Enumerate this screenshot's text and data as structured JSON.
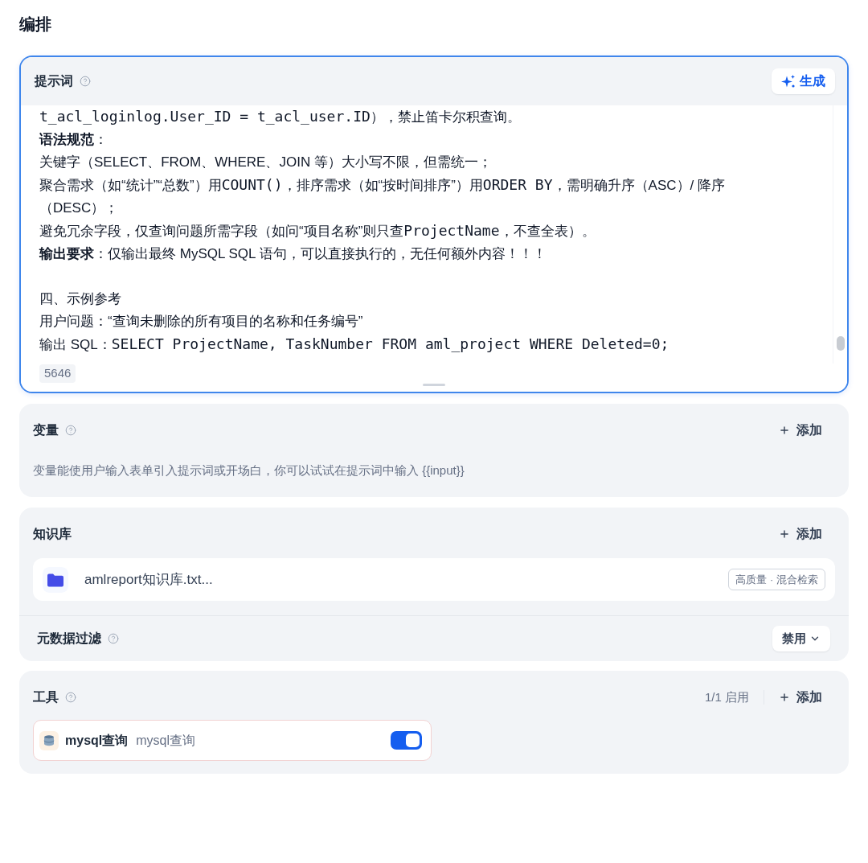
{
  "page_title": "编排",
  "prompt": {
    "title": "提示词",
    "help": true,
    "focused": true,
    "generate_label": "生成",
    "sections": [
      {
        "lines": [
          {
            "segments": [
              {
                "text": "t_acl_loginlog.User_ID = t_acl_user.ID",
                "mono": true
              },
              {
                "text": "），禁止笛卡尔积查询。",
                "mono": false
              }
            ]
          },
          {
            "segments": [
              {
                "text": "**语法规范**：",
                "mono": false
              }
            ]
          },
          {
            "segments": [
              {
                "text": "关键字（SELECT、FROM、WHERE、JOIN 等）大小写不限，但需统一；",
                "mono": false
              }
            ]
          },
          {
            "segments": [
              {
                "text": "聚合需求（如“统计”“总数”）用",
                "mono": false
              },
              {
                "text": "COUNT()",
                "mono": true
              },
              {
                "text": "，排序需求（如“按时间排序”）用",
                "mono": false
              },
              {
                "text": "ORDER BY",
                "mono": true
              },
              {
                "text": "，需明确升序（ASC）/ 降序",
                "mono": false
              }
            ]
          },
          {
            "segments": [
              {
                "text": "（DESC）；",
                "mono": false
              }
            ]
          },
          {
            "segments": [
              {
                "text": "避免冗余字段，仅查询问题所需字段（如问“项目名称”则只查",
                "mono": false
              },
              {
                "text": "ProjectName",
                "mono": true
              },
              {
                "text": "，不查全表）。",
                "mono": false
              }
            ]
          },
          {
            "segments": [
              {
                "text": "**输出要求**：仅输出最终 MySQL SQL 语句，可以直接执行的，无任何额外内容！！！",
                "mono": false
              }
            ]
          }
        ]
      },
      {
        "lines": [
          {
            "segments": [
              {
                "text": "四、示例参考",
                "mono": false
              }
            ]
          },
          {
            "segments": [
              {
                "text": "用户问题：“查询未删除的所有项目的名称和任务编号”",
                "mono": false
              }
            ]
          },
          {
            "segments": [
              {
                "text": "输出 SQL：",
                "mono": false
              },
              {
                "text": "SELECT ProjectName, TaskNumber FROM aml_project WHERE Deleted=0;",
                "mono": true
              }
            ]
          }
        ]
      }
    ],
    "char_count": "5646"
  },
  "variables": {
    "title": "变量",
    "help": true,
    "add_label": "添加",
    "description": "变量能使用户输入表单引入提示词或开场白，你可以试试在提示词中输入 {{input}}"
  },
  "knowledge": {
    "title": "知识库",
    "help": false,
    "add_label": "添加",
    "items": [
      {
        "name": "amlreport知识库.txt...",
        "tag": "高质量 · 混合检索"
      }
    ],
    "metadata_filter": {
      "label": "元数据过滤",
      "help": true,
      "value": "禁用"
    }
  },
  "tools": {
    "title": "工具",
    "help": true,
    "enabled_count": "1/1 启用",
    "add_label": "添加",
    "items": [
      {
        "name": "mysql查询",
        "description": "mysql查询",
        "on": true
      }
    ]
  }
}
